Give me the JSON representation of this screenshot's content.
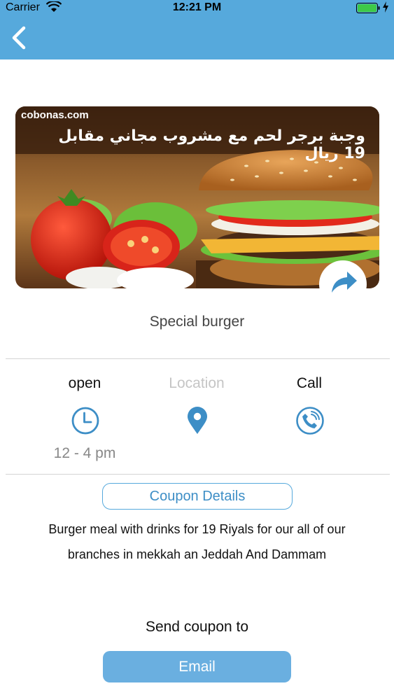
{
  "status_bar": {
    "carrier": "Carrier",
    "time": "12:21 PM"
  },
  "colors": {
    "accent": "#56a9dc",
    "button_fill": "#6aafe0",
    "icon": "#3d8ec6"
  },
  "banner": {
    "site": "cobonas.com",
    "promo_text": "وجبة برجر لحم مع مشروب مجاني مقابل 19 ريال"
  },
  "offer": {
    "title": "Special burger"
  },
  "info": {
    "open_label": "open",
    "hours": "12 - 4 pm",
    "location_label": "Location",
    "call_label": "Call"
  },
  "coupon": {
    "details_label": "Coupon Details",
    "description_line1": "Burger meal with drinks for 19 Riyals for our all of our",
    "description_line2": "branches in mekkah an Jeddah And Dammam"
  },
  "send": {
    "label": "Send coupon to",
    "email_label": "Email"
  }
}
